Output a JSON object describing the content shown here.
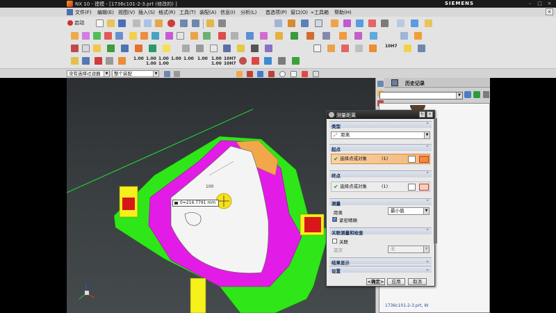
{
  "window": {
    "title": "NX 10 - 建模 - [1736c101-2-3.prt  (修改的) ]",
    "brand": "SIEMENS",
    "controls": {
      "minimize": "–",
      "maximize": "□",
      "close": "×"
    }
  },
  "menu": {
    "items": [
      "文件(F)",
      "编辑(E)",
      "视图(V)",
      "插入(S)",
      "格式(R)",
      "工具(T)",
      "装配(A)",
      "信息(I)",
      "分析(L)",
      "首选项(P)",
      "窗口(O)",
      "∝工具箱",
      "帮助(H)"
    ]
  },
  "toolbar": {
    "start_label": "启动",
    "scale_labels": [
      "1.00",
      "1.00\n1.00",
      "1.00\n1.00",
      "1.00",
      "1.00",
      "1.00",
      "1.00\n1.00",
      "10H7\n10H7",
      "10H7"
    ]
  },
  "filters": {
    "type_filter": "没有选择过滤器",
    "scope_filter": "整个装配"
  },
  "viewport": {
    "measurement_readout": "0=216.7791 mm",
    "ruler_label": "100"
  },
  "navigator": {
    "title": "历史记录",
    "footer_text": "1736c101-2-3.prt, W"
  },
  "dialog": {
    "title": "测量距离",
    "sections": {
      "type": "类型",
      "start": "起点",
      "end": "终点",
      "measure": "测量",
      "associated": "关联测量和检查",
      "results": "结果显示",
      "settings": "设置"
    },
    "type_value": "距离",
    "start_select": {
      "label": "选择点或对象",
      "count": "(1)"
    },
    "end_select": {
      "label": "选择点或对象",
      "count": "(1)"
    },
    "distance_label": "距离",
    "distance_value": "最小值",
    "precise_label": "紧密精确",
    "assoc_checkbox_label": "关联",
    "need_label": "需求",
    "need_value": "无",
    "buttons": {
      "ok": "<确定>",
      "apply": "应用",
      "cancel": "取消"
    },
    "close_glyph": "×",
    "reset_glyph": "↻"
  },
  "colors": {
    "magenta_face": "#e21ce6",
    "green_body": "#2fe619",
    "white_face": "#f4f4f4",
    "orange_face": "#f2a84a",
    "yellow_handle": "#f6f01c",
    "red_pocket": "#d61818",
    "green_line": "#23c93a",
    "select_highlight": "#f3b779"
  }
}
